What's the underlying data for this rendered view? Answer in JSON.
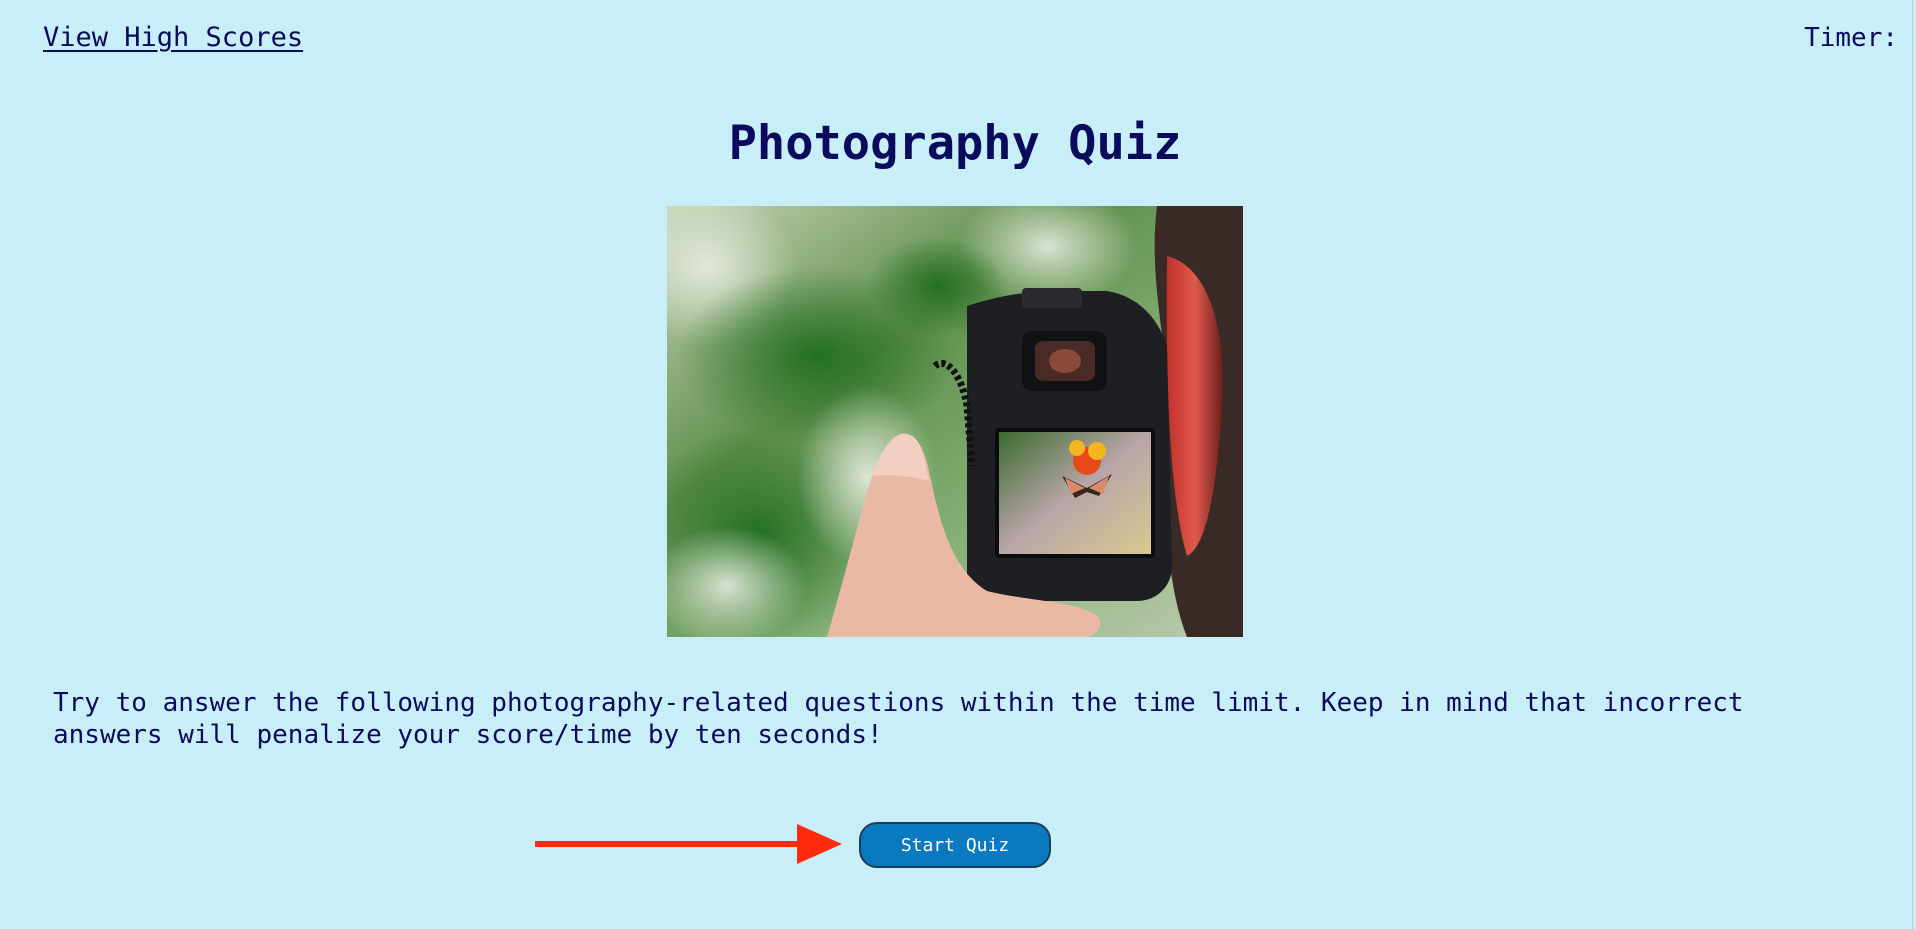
{
  "header": {
    "high_scores_link": "View High Scores",
    "timer_label": "Timer:",
    "timer_value": ""
  },
  "main": {
    "title": "Photography Quiz",
    "image_alt": "camera-photo",
    "description": "Try to answer the following photography-related questions within the time limit. Keep in mind that incorrect answers will penalize your score/time by ten seconds!",
    "start_button": "Start Quiz"
  },
  "colors": {
    "background": "#c8eff7",
    "text": "#0b0b5e",
    "button": "#0b79bf",
    "arrow": "#ff2a0f"
  }
}
